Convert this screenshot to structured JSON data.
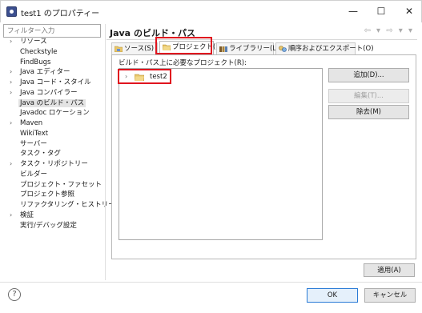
{
  "window": {
    "title": "test1 のプロパティー",
    "minimize_glyph": "—",
    "maximize_glyph": "☐",
    "close_glyph": "✕"
  },
  "sidebar": {
    "filter_placeholder": "フィルター入力",
    "items": [
      {
        "label": "リソース",
        "expandable": true
      },
      {
        "label": "Checkstyle",
        "expandable": false
      },
      {
        "label": "FindBugs",
        "expandable": false
      },
      {
        "label": "Java エディター",
        "expandable": true
      },
      {
        "label": "Java コード・スタイル",
        "expandable": true
      },
      {
        "label": "Java コンパイラー",
        "expandable": true
      },
      {
        "label": "Java のビルド・パス",
        "expandable": false,
        "selected": true
      },
      {
        "label": "Javadoc ロケーション",
        "expandable": false
      },
      {
        "label": "Maven",
        "expandable": true
      },
      {
        "label": "WikiText",
        "expandable": false
      },
      {
        "label": "サーバー",
        "expandable": false
      },
      {
        "label": "タスク・タグ",
        "expandable": false
      },
      {
        "label": "タスク・リポジトリー",
        "expandable": true
      },
      {
        "label": "ビルダー",
        "expandable": false
      },
      {
        "label": "プロジェクト・ファセット",
        "expandable": false
      },
      {
        "label": "プロジェクト参照",
        "expandable": false
      },
      {
        "label": "リファクタリング・ヒストリー",
        "expandable": false
      },
      {
        "label": "検証",
        "expandable": true
      },
      {
        "label": "実行/デバッグ設定",
        "expandable": false
      }
    ]
  },
  "main": {
    "page_title": "Java のビルド・パス",
    "nav_arrows": "⇦ ▾ ⇨ ▾ ▾",
    "tabs": [
      {
        "label": "ソース(S)",
        "icon": "source-folder-icon",
        "active": false
      },
      {
        "label": "プロジェクト(P)",
        "icon": "project-icon",
        "active": true
      },
      {
        "label": "ライブラリー(L)",
        "icon": "library-icon",
        "active": false
      },
      {
        "label": "順序およびエクスポート(O)",
        "icon": "order-export-icon",
        "active": false
      }
    ],
    "panel_label": "ビルド・パス上に必要なプロジェクト(R):",
    "tree_items": [
      {
        "label": "test2",
        "expandable": true
      }
    ],
    "buttons": {
      "add": "追加(D)...",
      "edit": "編集(T)...",
      "remove": "除去(M)"
    },
    "apply": "適用(A)"
  },
  "footer": {
    "help_glyph": "?",
    "ok": "OK",
    "cancel": "キャンセル"
  },
  "colors": {
    "highlight_red": "#e0141e",
    "selection_bg": "#e3e3e3",
    "default_button_border": "#2a7bd6",
    "folder_yellow": "#e8c66a"
  },
  "icons": {
    "expand_collapsed": "›",
    "tree_expander": "›"
  }
}
